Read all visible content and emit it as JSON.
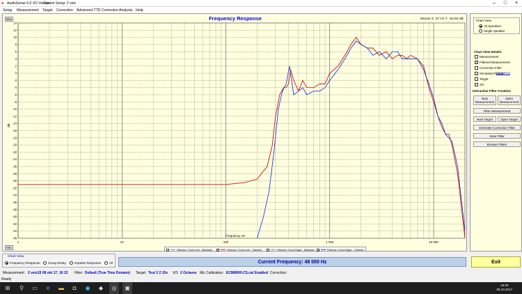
{
  "titlebar": {
    "app": "AudioSense 5.0 XO Version",
    "setup": "Current Setup: 2 veis"
  },
  "menu": [
    "Setup",
    "Measurement",
    "Target",
    "Correction",
    "Advanced TTD Correction",
    "Analysis",
    "Help"
  ],
  "chart": {
    "title": "Frequency Response",
    "mouse": "Mouse X: 27 Hz  Y: -54.54 dB",
    "min_label": "Min",
    "max_label": "Max",
    "xlabel": "Frequency Hz",
    "ylabel": "dB"
  },
  "chart_data": {
    "type": "line",
    "xscale": "log",
    "xlim": [
      1,
      20000
    ],
    "ylim": [
      -46,
      14
    ],
    "x_ticks": [
      "1",
      "10",
      "100",
      "1 000",
      "10 000"
    ],
    "y_ticks": [
      "14",
      "12",
      "10",
      "8",
      "6",
      "4",
      "2",
      "0",
      "-2",
      "-4",
      "-6",
      "-8",
      "-10",
      "-12",
      "-14",
      "-16",
      "-18",
      "-20",
      "-22",
      "-24",
      "-26",
      "-28",
      "-30",
      "-32",
      "-34",
      "-36",
      "-38",
      "-40",
      "-42",
      "-44",
      "-46"
    ],
    "series": [
      {
        "name": "Filtered Front Left: Tweeter",
        "color": "#d01010",
        "x": [
          1,
          10,
          100,
          150,
          200,
          250,
          280,
          300,
          330,
          360,
          380,
          400,
          420,
          450,
          500,
          550,
          600,
          700,
          800,
          900,
          1000,
          1200,
          1400,
          1600,
          1800,
          2000,
          2300,
          2600,
          3000,
          3500,
          4000,
          4500,
          5000,
          5500,
          6000,
          7000,
          8000,
          9000,
          10000,
          11000,
          12000,
          13000,
          14000,
          15000,
          17000,
          20000
        ],
        "y": [
          -31,
          -31,
          -31,
          -30.5,
          -29.5,
          -26,
          -20,
          -12,
          -6,
          -4,
          -4,
          -3,
          1,
          -2,
          -5,
          -2,
          -4,
          -4,
          -3,
          -3,
          0,
          2,
          5,
          8,
          10,
          8,
          7,
          7,
          5,
          6,
          4,
          5,
          5,
          4,
          5,
          4,
          2,
          -4,
          -8,
          -12,
          -15,
          -17,
          -17,
          -20,
          -28,
          -46
        ]
      },
      {
        "name": "Filtered Front Right: Tweeter",
        "color": "#2040d0",
        "x": [
          200,
          230,
          260,
          290,
          320,
          350,
          380,
          410,
          450,
          500,
          550,
          600,
          700,
          800,
          900,
          1000,
          1200,
          1400,
          1600,
          1800,
          2000,
          2300,
          2600,
          3000,
          3500,
          4000,
          4500,
          5000,
          5500,
          6000,
          7000,
          8000,
          9000,
          10000,
          11000,
          12000,
          13000,
          14000,
          15000,
          17000,
          20000
        ],
        "y": [
          -46,
          -40,
          -33,
          -22,
          -10,
          -5,
          -3,
          2,
          -6,
          -5,
          -4,
          -6,
          -5,
          -5,
          -4,
          -2,
          1,
          4,
          7,
          9,
          8,
          7,
          5,
          6,
          4,
          6,
          6,
          4,
          4,
          4,
          4,
          1,
          -3,
          -7,
          -12,
          -14,
          -17,
          -18,
          -19,
          -26,
          -44
        ]
      }
    ]
  },
  "legend": [
    {
      "label": "Filtered: Front Left : Midbass",
      "color": "#888888",
      "checked": false
    },
    {
      "label": "Filtered: Front Left : Tweeter",
      "color": "#d01010",
      "checked": true
    },
    {
      "label": "Filtered: Front Right : Midbass",
      "color": "#888888",
      "checked": false
    },
    {
      "label": "Filtered: Front Right : Tweeter",
      "color": "#2040d0",
      "checked": true
    }
  ],
  "right_panel": {
    "chart_view_title": "Chart View",
    "all_speakers": "All Speakers",
    "single_speaker": "Single Speaker",
    "details_title": "Chart View Details:",
    "details": [
      {
        "label": "Measurement",
        "checked": false
      },
      {
        "label": "Filtered Measurement",
        "checked": true
      },
      {
        "label": "Correction Filter",
        "checked": false
      },
      {
        "label": "Simulated Result",
        "checked": false
      },
      {
        "label": "Target",
        "checked": false
      },
      {
        "label": "XO",
        "checked": false
      }
    ],
    "smoothed": "(Smoothed)",
    "interactive_title": "Interactive Filter Creation:",
    "new_measurement": "New Measurement",
    "open_measurement": "Open Measurement",
    "filter_measurement": "Filter Measurement",
    "new_target": "New Target",
    "open_target": "Open Target",
    "generate_correction": "Generate Correction Filter",
    "save_filter": "Save Filter",
    "browse_filters": "Browse Filters"
  },
  "chart_view": {
    "title": "Chart View",
    "options": [
      "Frequency Response",
      "Group Delay",
      "Impulse Response",
      "All"
    ]
  },
  "current_frequency": "Current Frequency: 48 000 Hz",
  "exit": "Exit",
  "status": {
    "measurement_label": "Measurement:",
    "measurement_value": "2 veis15 08 okt 17_16 23",
    "filter_label": "Filter:",
    "filter_value": "Default (True Time Domain)",
    "target_label": "Target:",
    "target_value": "Test 3 2 15v",
    "xo_label": "XO:",
    "xo_value": "2 Octaves",
    "mic_label": "Mic Calibration:",
    "mic_value": "ECM8000-CS.cal Enabled",
    "correction_label": "Correction:"
  },
  "ready": "Ready",
  "clock": {
    "time": "16:20",
    "date": "08.10.2017"
  }
}
